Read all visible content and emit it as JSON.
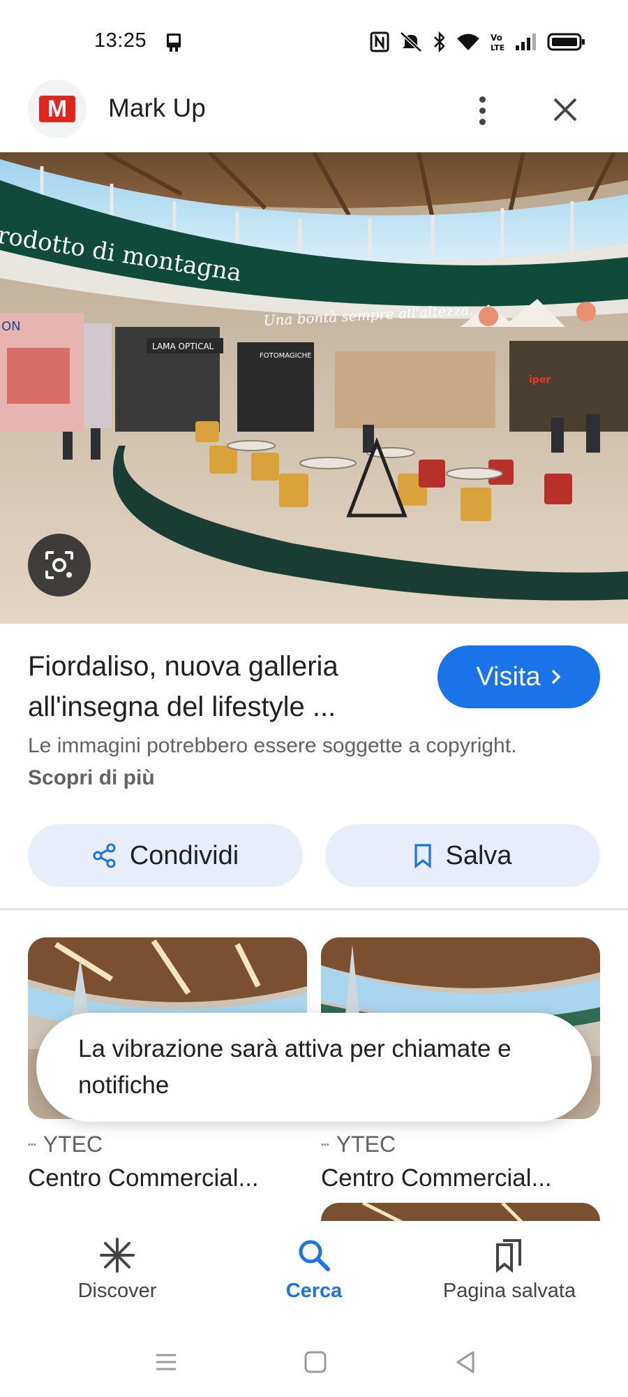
{
  "status_bar": {
    "time": "13:25",
    "icons": [
      "screen-cast-icon",
      "nfc-icon",
      "mute-icon",
      "bluetooth-icon",
      "wifi-icon",
      "volte-icon",
      "signal-icon",
      "battery-icon"
    ]
  },
  "header": {
    "site_name": "Mark Up",
    "logo_letter": "M"
  },
  "hero": {
    "banner_text": "rodotto di montagna",
    "banner_slogan": "Una bontà sempre all'altezza.",
    "shop_1": "LAMA OPTICAL",
    "shop_2": "FOTOMAGICHE",
    "shop_3": "ON",
    "shop_4": "iper",
    "lens_icon": "google-lens-icon"
  },
  "result": {
    "title": "Fiordaliso, nuova galleria all'insegna del lifestyle ...",
    "visit_label": "Visita",
    "copyright_text": "Le immagini potrebbero essere soggette a copyright.",
    "learn_more": "Scopri di più"
  },
  "actions": {
    "share_label": "Condividi",
    "save_label": "Salva"
  },
  "related": [
    {
      "source": "YTEC",
      "title": "Centro Commercial..."
    },
    {
      "source": "YTEC",
      "title": "Centro Commercial..."
    }
  ],
  "toast": {
    "message": "La vibrazione sarà attiva per chiamate e notifiche"
  },
  "bottom_nav": {
    "discover": "Discover",
    "search": "Cerca",
    "saved": "Pagina salvata"
  },
  "colors": {
    "accent": "#1a73e8",
    "chip_bg": "#e8eef9",
    "logo_red": "#e1251b"
  }
}
